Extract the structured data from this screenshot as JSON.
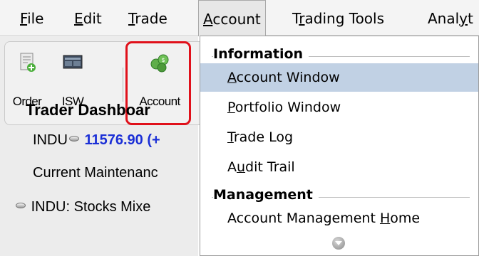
{
  "menubar": {
    "items": [
      {
        "ul": "F",
        "rest": "ile"
      },
      {
        "ul": "E",
        "rest": "dit"
      },
      {
        "ul": "T",
        "rest": "rade"
      },
      {
        "ul": "A",
        "rest": "ccount"
      },
      {
        "pre": "T",
        "ul": "r",
        "rest": "ading Tools"
      },
      {
        "pre": "Anal",
        "ul": "y",
        "rest": "t"
      }
    ]
  },
  "toolbar": {
    "order_label": "Order",
    "isw_label": "ISW",
    "account_label": "Account"
  },
  "dashboard": {
    "title": "Trader Dashboar",
    "index_symbol": "INDU",
    "index_value": "11576.90 (+",
    "maintenance": "Current Maintenanc",
    "news": "INDU: Stocks Mixe"
  },
  "dropdown": {
    "group_information": "Information",
    "group_management": "Management",
    "items": [
      {
        "ul": "A",
        "rest": "ccount Window"
      },
      {
        "ul": "P",
        "rest": "ortfolio Window"
      },
      {
        "ul": "T",
        "rest": "rade Log"
      },
      {
        "pre": "A",
        "ul": "u",
        "rest": "dit Trail"
      }
    ],
    "management_item": {
      "pre": "Account Management ",
      "ul": "H",
      "rest": "ome"
    }
  },
  "colors": {
    "highlight_border": "#e0101a",
    "hover_item": "#c1d1e4",
    "index_blue": "#1b2fd6"
  }
}
